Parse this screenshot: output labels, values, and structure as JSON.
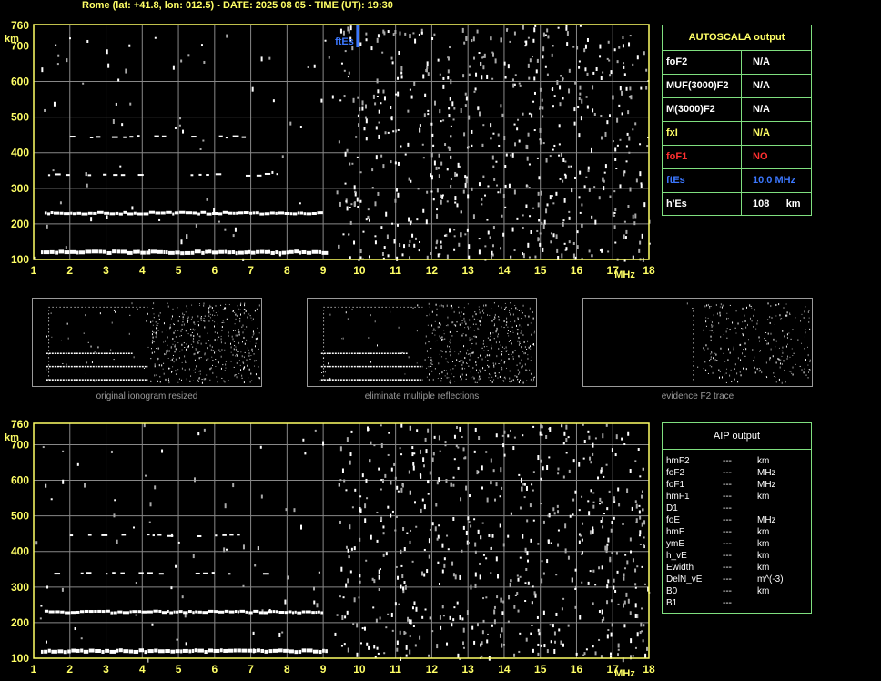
{
  "header": "Rome  (lat: +41.8, lon: 012.5) - DATE: 2025 08 05 - TIME (UT): 19:30",
  "colors": {
    "axis": "#ffff66",
    "grid": "#888888",
    "panel": "#7fdf7f",
    "trace": "#ffffff",
    "es": "#3c78ff",
    "red": "#ff3030"
  },
  "top_plot": {
    "es_label": "ftEs",
    "unit_x": "MHz",
    "unit_y": "km"
  },
  "chart_data": [
    {
      "type": "scatter",
      "title": "",
      "xlabel": "MHz",
      "ylabel": "km",
      "xlim": [
        1,
        18
      ],
      "ylim": [
        100,
        760
      ],
      "x_ticks": [
        "1",
        "2",
        "3",
        "4",
        "5",
        "6",
        "7",
        "8",
        "9",
        "10",
        "11",
        "12",
        "13",
        "14",
        "15",
        "16",
        "17",
        "18"
      ],
      "y_ticks": [
        "100",
        "200",
        "300",
        "400",
        "500",
        "600",
        "700",
        "760"
      ],
      "grid": true,
      "series": [
        {
          "name": "",
          "x_start": 1.2,
          "x_end": 9.1,
          "y": 120
        },
        {
          "name": "",
          "x_start": 1.3,
          "x_end": 8.9,
          "y": 230
        },
        {
          "name": "",
          "x_start": 1.4,
          "x_end": 8.0,
          "y": 338
        },
        {
          "name": "",
          "x_start": 2.0,
          "x_end": 7.0,
          "y": 445
        }
      ],
      "markers": [
        {
          "label": "ftEs",
          "x": 10.0
        }
      ]
    },
    {
      "type": "scatter",
      "title": "",
      "xlabel": "MHz",
      "ylabel": "km",
      "xlim": [
        1,
        18
      ],
      "ylim": [
        100,
        760
      ],
      "x_ticks": [
        "1",
        "2",
        "3",
        "4",
        "5",
        "6",
        "7",
        "8",
        "9",
        "10",
        "11",
        "12",
        "13",
        "14",
        "15",
        "16",
        "17",
        "18"
      ],
      "y_ticks": [
        "100",
        "200",
        "300",
        "400",
        "500",
        "600",
        "700",
        "760"
      ],
      "grid": true,
      "series": [
        {
          "name": "",
          "x_start": 1.2,
          "x_end": 9.1,
          "y": 120
        },
        {
          "name": "",
          "x_start": 1.3,
          "x_end": 9.0,
          "y": 230
        },
        {
          "name": "",
          "x_start": 1.4,
          "x_end": 7.5,
          "y": 338
        },
        {
          "name": "",
          "x_start": 2.0,
          "x_end": 6.9,
          "y": 445
        }
      ]
    }
  ],
  "thumbnails": [
    {
      "caption": "original ionogram resized"
    },
    {
      "caption": "eliminate multiple reflections"
    },
    {
      "caption": "evidence F2 trace"
    }
  ],
  "autoscala": {
    "title": "AUTOSCALA output",
    "rows": [
      {
        "label": "foF2",
        "value": "N/A",
        "color": "#ffffff"
      },
      {
        "label": "MUF(3000)F2",
        "value": "N/A",
        "color": "#ffffff"
      },
      {
        "label": "M(3000)F2",
        "value": "N/A",
        "color": "#ffffff"
      },
      {
        "label": "fxI",
        "value": "N/A",
        "color": "#ffff66"
      },
      {
        "label": "foF1",
        "value": "NO",
        "color": "#ff3030"
      },
      {
        "label": "ftEs",
        "value": "10.0 MHz",
        "color": "#3c78ff"
      },
      {
        "label": "h'Es",
        "value": "108      km",
        "color": "#ffffff"
      }
    ]
  },
  "aip": {
    "title": "AIP output",
    "rows": [
      {
        "label": "hmF2",
        "value": "---",
        "unit": "km"
      },
      {
        "label": "foF2",
        "value": "---",
        "unit": "MHz"
      },
      {
        "label": "foF1",
        "value": "---",
        "unit": "MHz"
      },
      {
        "label": "hmF1",
        "value": "---",
        "unit": "km"
      },
      {
        "label": "D1",
        "value": "---",
        "unit": ""
      },
      {
        "label": "foE",
        "value": "---",
        "unit": "MHz"
      },
      {
        "label": "hmE",
        "value": "---",
        "unit": "km"
      },
      {
        "label": "ymE",
        "value": "---",
        "unit": "km"
      },
      {
        "label": "h_vE",
        "value": "---",
        "unit": "km"
      },
      {
        "label": "Ewidth",
        "value": "---",
        "unit": "km"
      },
      {
        "label": "DelN_vE",
        "value": "---",
        "unit": "m^(-3)"
      },
      {
        "label": "B0",
        "value": "---",
        "unit": "km"
      },
      {
        "label": "B1",
        "value": "---",
        "unit": ""
      }
    ]
  }
}
